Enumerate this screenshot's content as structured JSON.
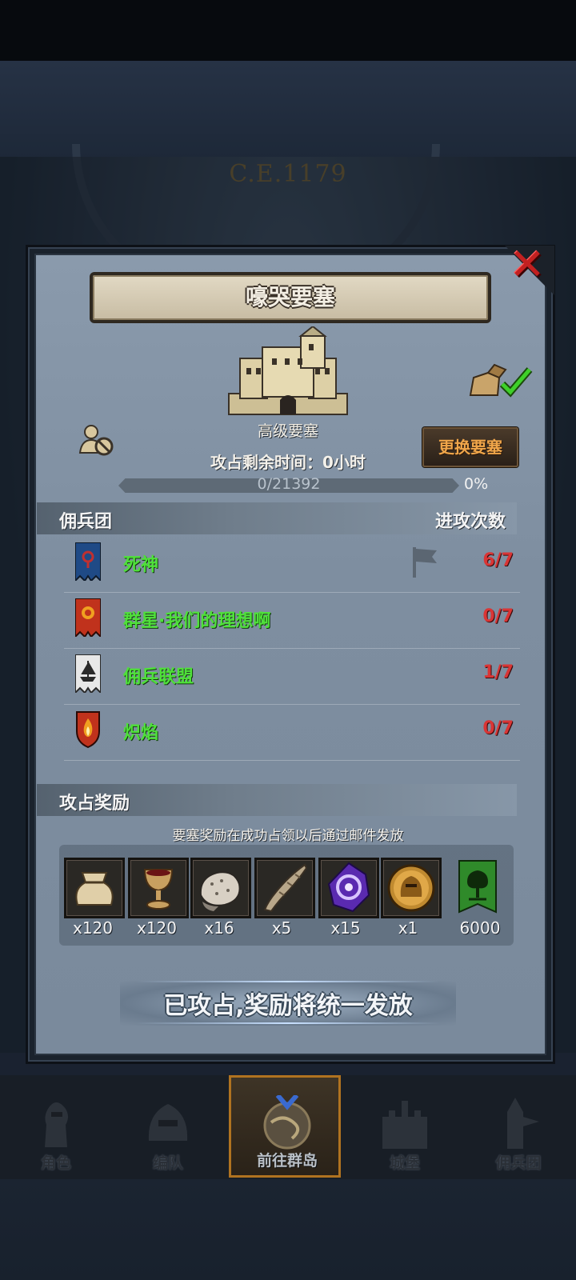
{
  "background": {
    "year": "C.E.1179"
  },
  "dialog": {
    "title": "嚎哭要塞",
    "castle_type": "高级要塞",
    "remaining_label": "攻占剩余时间：",
    "remaining_value": "0小时",
    "change_button": "更换要塞",
    "progress_text": "0/21392",
    "progress_percent": "0%",
    "progress_fraction": 0
  },
  "guilds_section": {
    "title": "佣兵团",
    "count_header": "进攻次数",
    "rows": [
      {
        "name": "死神",
        "count": "6/7",
        "banner": "blue-banner-icon",
        "flag": true
      },
      {
        "name": "群星·我们的理想啊",
        "count": "0/7",
        "banner": "red-sun-banner-icon",
        "flag": false
      },
      {
        "name": "佣兵联盟",
        "count": "1/7",
        "banner": "ship-banner-icon",
        "flag": false
      },
      {
        "name": "炽焰",
        "count": "0/7",
        "banner": "flame-shield-icon",
        "flag": false
      }
    ]
  },
  "rewards_section": {
    "title": "攻占奖励",
    "note": "要塞奖励在成功占领以后通过邮件发放",
    "items": [
      {
        "icon": "coin-sack-icon",
        "count": "x120"
      },
      {
        "icon": "goblet-icon",
        "count": "x120"
      },
      {
        "icon": "ore-rock-icon",
        "count": "x16"
      },
      {
        "icon": "horn-icon",
        "count": "x5"
      },
      {
        "icon": "purple-crystal-icon",
        "count": "x15"
      },
      {
        "icon": "golden-helmet-medal-icon",
        "count": "x1"
      },
      {
        "icon": "green-tree-banner-icon",
        "count": "6000"
      }
    ]
  },
  "action_button": "已攻占,奖励将统一发放",
  "bottom_nav": [
    {
      "label": "角色",
      "active": false
    },
    {
      "label": "编队",
      "active": false
    },
    {
      "label": "前往群岛",
      "active": true
    },
    {
      "label": "城堡",
      "active": false
    },
    {
      "label": "佣兵团",
      "active": false
    }
  ],
  "colors": {
    "count_red": "#d93535",
    "guild_green": "#4fe03a",
    "accent_orange": "#f0a64a"
  }
}
